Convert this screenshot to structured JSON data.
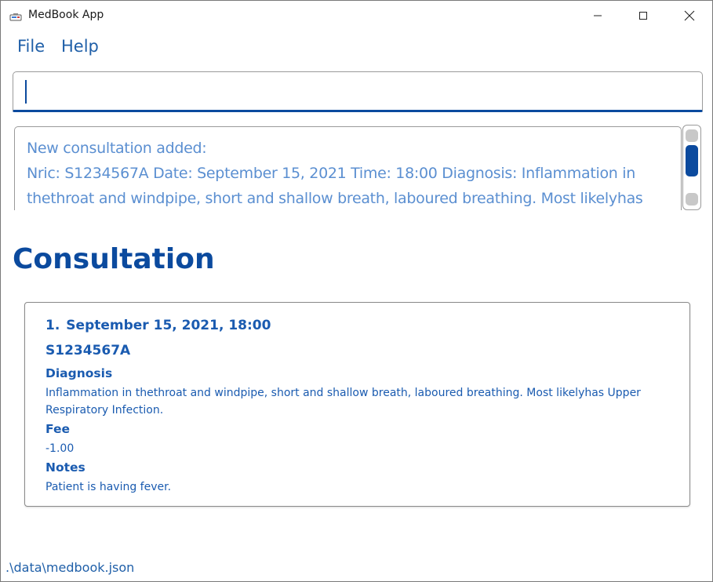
{
  "window": {
    "title": "MedBook App",
    "icon": "app-icon",
    "controls": {
      "minimize": "minimize-icon",
      "maximize": "maximize-icon",
      "close": "close-icon"
    }
  },
  "menu": {
    "file_label": "File",
    "help_label": "Help"
  },
  "command": {
    "value": "",
    "placeholder": ""
  },
  "result": {
    "lines": [
      "New consultation added:",
      "Nric: S1234567A Date: September 15, 2021 Time: 18:00 Diagnosis: Inflammation in",
      "thethroat and windpipe, short and shallow breath, laboured breathing. Most likelyhas"
    ]
  },
  "section": {
    "title": "Consultation"
  },
  "consultation": {
    "index": "1.",
    "datetime": "September 15, 2021, 18:00",
    "nric": "S1234567A",
    "diagnosis_label": "Diagnosis",
    "diagnosis": "Inflammation in thethroat and windpipe, short and shallow breath, laboured breathing. Most likelyhas Upper Respiratory Infection.",
    "fee_label": "Fee",
    "fee": "-1.00",
    "notes_label": "Notes",
    "notes": "Patient is having fever."
  },
  "status": {
    "file_path": ".\\data\\medbook.json"
  },
  "colors": {
    "accent": "#0b4a9e",
    "text_blue": "#1a5bb0",
    "result_text": "#5b8fd1"
  }
}
